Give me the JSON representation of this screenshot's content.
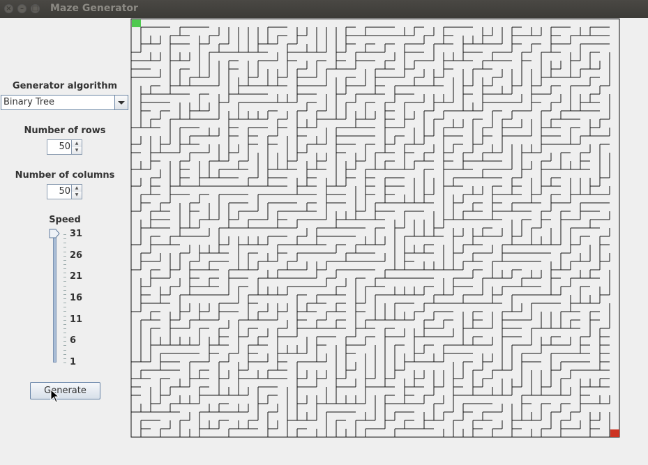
{
  "window": {
    "title": "Maze Generator",
    "controls": [
      "close-icon",
      "minimize-icon",
      "maximize-icon"
    ]
  },
  "sidebar": {
    "algorithm_label": "Generator algorithm",
    "algorithm_value": "Binary Tree",
    "rows_label": "Number of rows",
    "rows_value": "50",
    "columns_label": "Number of columns",
    "columns_value": "50",
    "speed_label": "Speed",
    "speed_ticks": [
      "31",
      "26",
      "21",
      "16",
      "11",
      "6",
      "1"
    ],
    "speed_value": 31,
    "speed_range": [
      1,
      31
    ],
    "generate_label": "Generate"
  },
  "maze": {
    "algorithm": "Binary Tree",
    "rows": 50,
    "columns": 50,
    "start_color": "#4fc94f",
    "end_color": "#cc3322",
    "wall_color": "#111111",
    "background": "#efefef"
  },
  "colors": {
    "titlebar": "#3c3b37",
    "accent": "#6582a6"
  }
}
